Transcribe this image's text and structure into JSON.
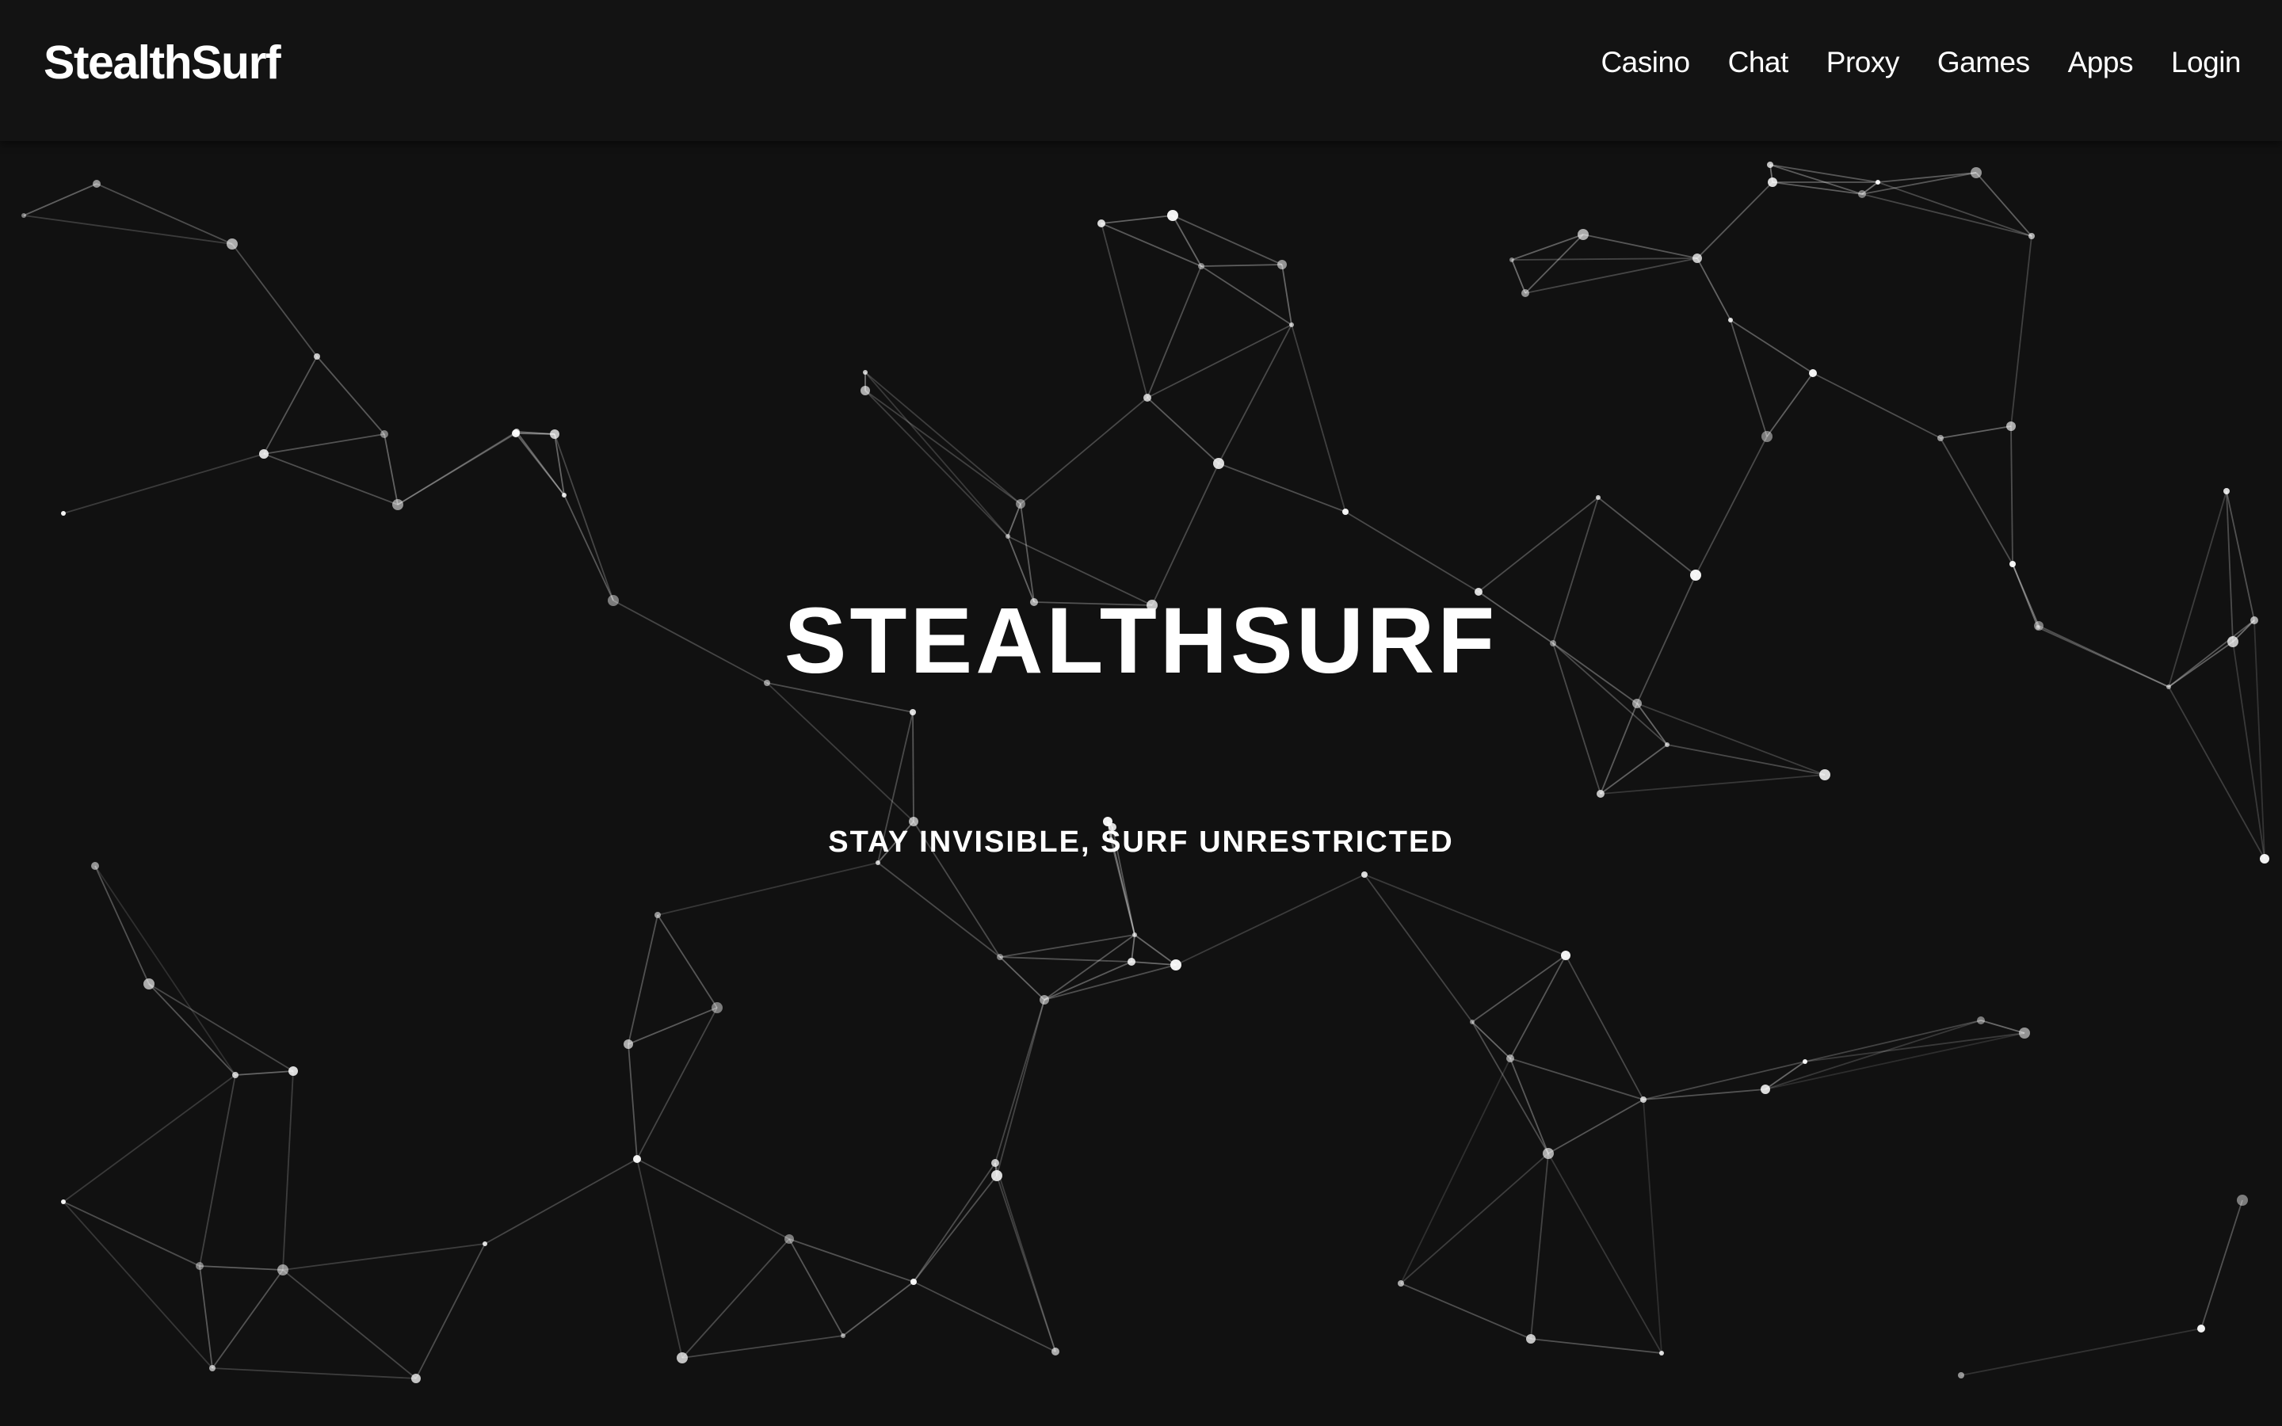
{
  "nav": {
    "brand": "StealthSurf",
    "links": [
      {
        "label": "Casino"
      },
      {
        "label": "Chat"
      },
      {
        "label": "Proxy"
      },
      {
        "label": "Games"
      },
      {
        "label": "Apps"
      },
      {
        "label": "Login"
      }
    ]
  },
  "hero": {
    "title": "STEALTHSURF",
    "subtitle": "STAY INVISIBLE, SURF UNRESTRICTED"
  },
  "theme": {
    "background": "#111111",
    "navbar": "#131313",
    "text": "#ffffff",
    "network": "#ffffff"
  }
}
